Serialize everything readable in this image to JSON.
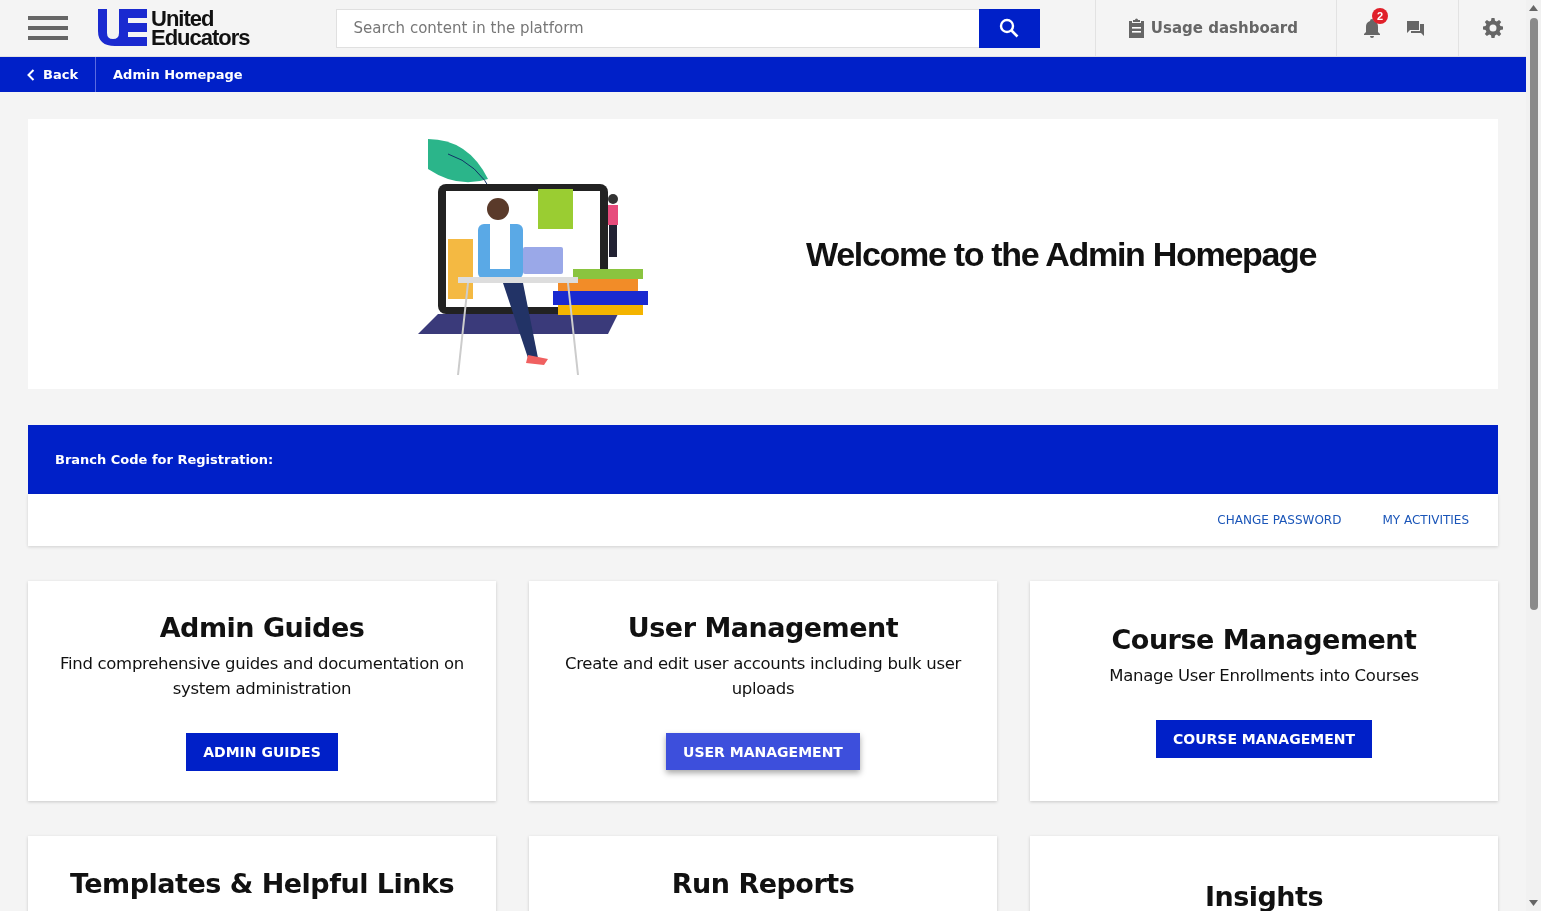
{
  "header": {
    "logo_line_1": "United",
    "logo_line_2": "Educators",
    "search": {
      "placeholder": "Search content in the platform"
    },
    "usage_dashboard": "Usage dashboard",
    "notification_count": "2"
  },
  "breadcrumb": {
    "back": "Back",
    "current": "Admin Homepage"
  },
  "hero": {
    "title": "Welcome to the Admin Homepage"
  },
  "branch": {
    "label": "Branch Code for Registration:",
    "links": [
      "CHANGE PASSWORD",
      "MY ACTIVITIES"
    ]
  },
  "cards": [
    {
      "title": "Admin Guides",
      "description": "Find comprehensive guides and documentation on system administration",
      "button": "ADMIN GUIDES",
      "hovered": false
    },
    {
      "title": "User Management",
      "description": "Create and edit user accounts including bulk user uploads",
      "button": "USER MANAGEMENT",
      "hovered": true
    },
    {
      "title": "Course Management",
      "description": "Manage User Enrollments into Courses",
      "button": "COURSE MANAGEMENT",
      "hovered": false
    },
    {
      "title": "Templates & Helpful Links"
    },
    {
      "title": "Run Reports"
    },
    {
      "title": "Insights"
    }
  ]
}
